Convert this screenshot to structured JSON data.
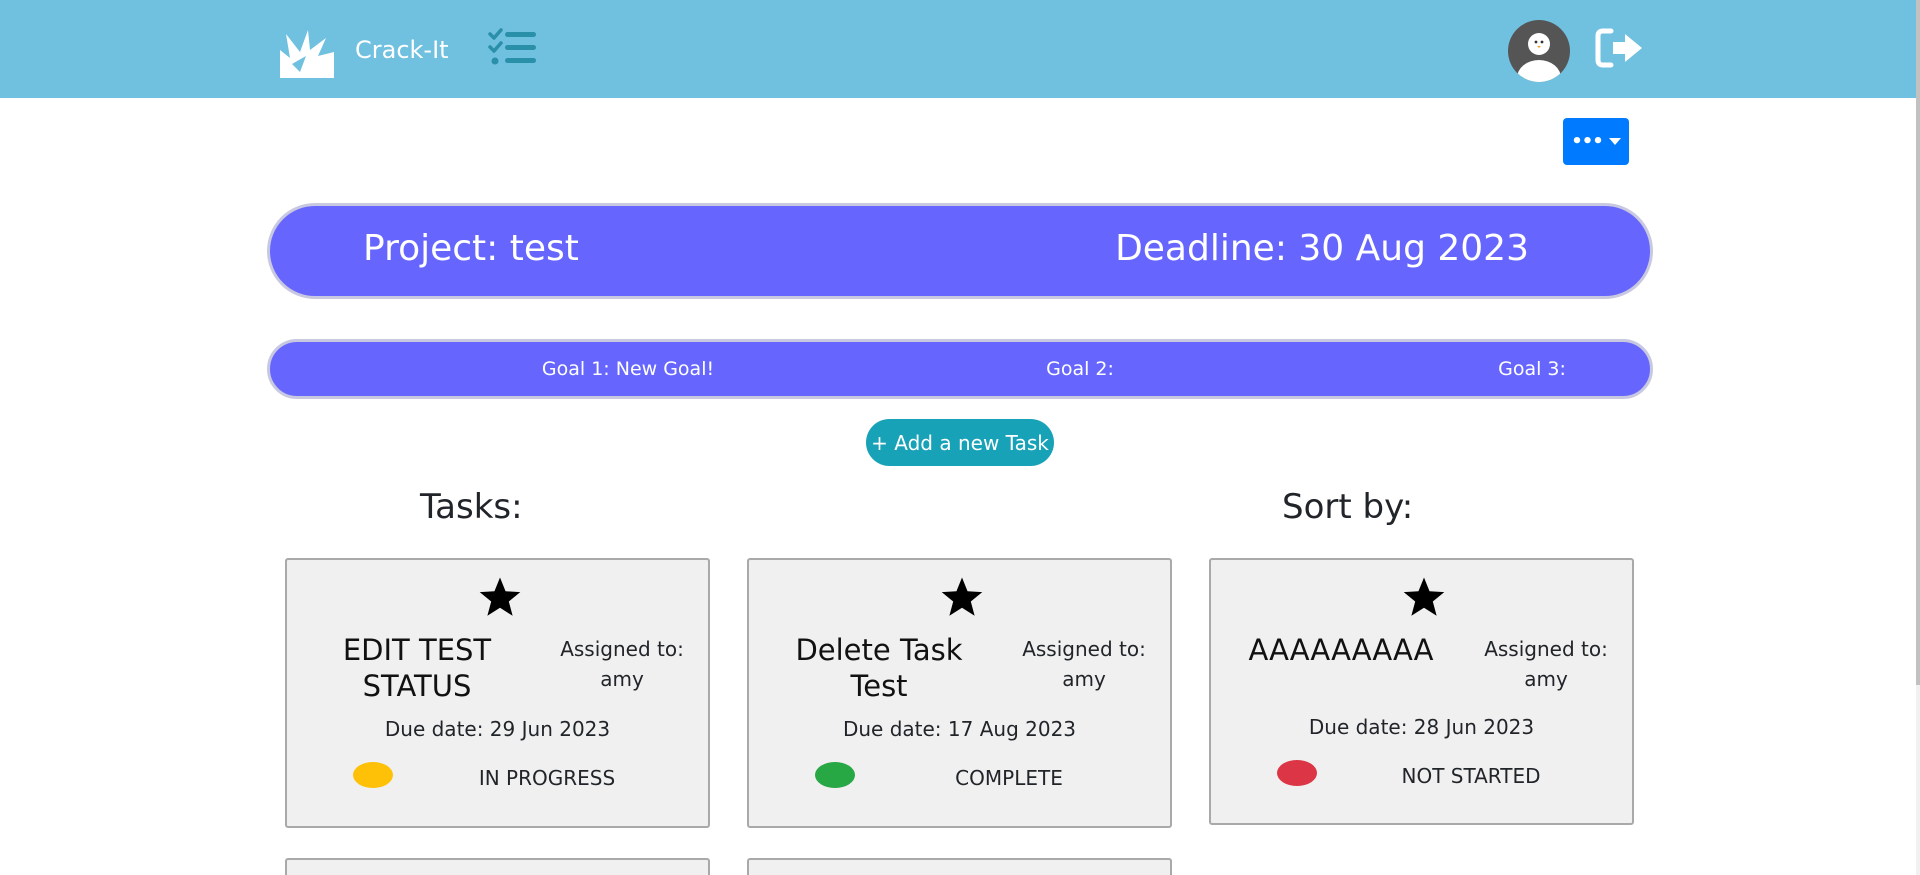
{
  "brand": {
    "name": "Crack-It",
    "logo_icon": "crack-logo-icon"
  },
  "nav": {
    "list_icon": "checklist-icon",
    "avatar_icon": "avatar-icon",
    "logout_icon": "logout-icon"
  },
  "actions": {
    "more_label": "•••"
  },
  "project": {
    "name": "Project: test",
    "deadline": "Deadline: 30 Aug 2023"
  },
  "goals": [
    {
      "label": "Goal 1: New Goal!"
    },
    {
      "label": "Goal 2:"
    },
    {
      "label": "Goal 3:"
    }
  ],
  "add_task_label": "+ Add a new Task",
  "tasks_heading": "Tasks:",
  "sort_heading": "Sort by:",
  "tasks": [
    {
      "title": "EDIT TEST STATUS",
      "assigned_label": "Assigned to:",
      "assignee": "amy",
      "due": "Due date: 29 Jun 2023",
      "status": "IN PROGRESS",
      "status_color": "#ffc107"
    },
    {
      "title": "Delete Task Test",
      "assigned_label": "Assigned to:",
      "assignee": "amy",
      "due": "Due date: 17 Aug 2023",
      "status": "COMPLETE",
      "status_color": "#28a745"
    },
    {
      "title": "AAAAAAAAA",
      "assigned_label": "Assigned to:",
      "assignee": "amy",
      "due": "Due date: 28 Jun 2023",
      "status": "NOT STARTED",
      "status_color": "#dc3545"
    }
  ],
  "colors": {
    "navbar": "#70c0e0",
    "banner": "#6666ff",
    "primary": "#007bff",
    "info": "#17a2b8"
  }
}
